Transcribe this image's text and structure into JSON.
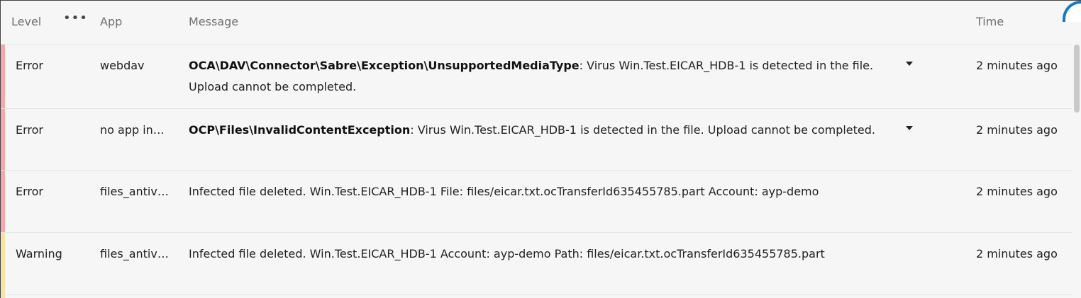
{
  "header": {
    "level": "Level",
    "menu": "•••",
    "app": "App",
    "message": "Message",
    "time": "Time"
  },
  "rows": [
    {
      "level": "Error",
      "app": "webdav",
      "exception": "OCA\\DAV\\Connector\\Sabre\\Exception\\UnsupportedMediaType",
      "message": ": Virus Win.Test.EICAR_HDB-1 is detected in the file. Upload cannot be completed.",
      "time": "2 minutes ago",
      "color": "#f4a7ad"
    },
    {
      "level": "Error",
      "app": "no app in…",
      "exception": "OCP\\Files\\InvalidContentException",
      "message": ": Virus Win.Test.EICAR_HDB-1 is detected in the file. Upload cannot be completed.",
      "time": "2 minutes ago",
      "color": "#f4a7ad"
    },
    {
      "level": "Error",
      "app": "files_antiv…",
      "message": "Infected file deleted. Win.Test.EICAR_HDB-1 File: files/eicar.txt.ocTransferId635455785.part Account: ayp-demo",
      "time": "2 minutes ago",
      "color": "#f4a7ad"
    },
    {
      "level": "Warning",
      "app": "files_antiv…",
      "message": "Infected file deleted. Win.Test.EICAR_HDB-1 Account: ayp-demo Path: files/eicar.txt.ocTransferId635455785.part",
      "time": "2 minutes ago",
      "color": "#f6e3a4"
    }
  ]
}
